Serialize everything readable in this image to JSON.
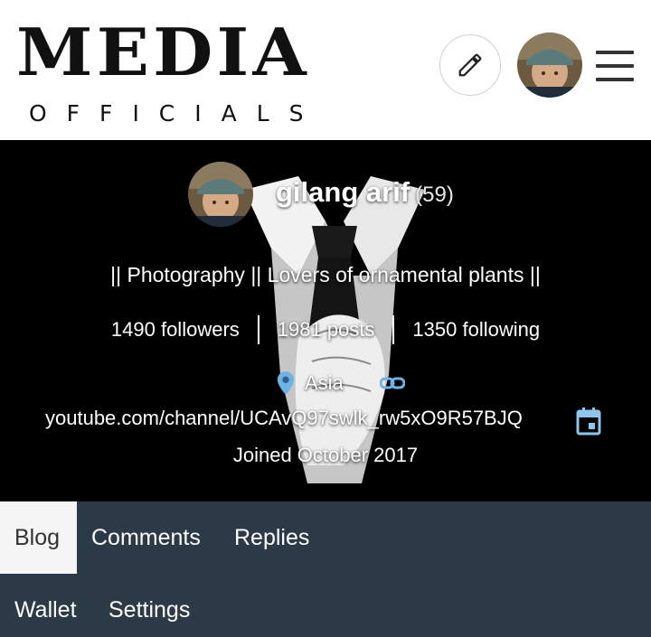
{
  "header": {
    "logo_main": "MEDIA",
    "logo_sub": "OFFICIALS",
    "edit_icon": "pencil-icon",
    "menu_icon": "hamburger-icon"
  },
  "profile": {
    "name": "gilang arif",
    "reputation": "(59)",
    "about": "|| Photography || Lovers of ornamental plants ||",
    "followers": "1490 followers",
    "posts": "1981 posts",
    "following": "1350 following",
    "location": "Asia",
    "website": "youtube.com/channel/UCAvQ97swlk_rw5xO9R57BJQ",
    "joined": "Joined October 2017"
  },
  "tabs": [
    {
      "label": "Blog",
      "active": true
    },
    {
      "label": "Comments",
      "active": false
    },
    {
      "label": "Replies",
      "active": false
    },
    {
      "label": "Wallet",
      "active": false
    },
    {
      "label": "Settings",
      "active": false
    }
  ],
  "colors": {
    "cover_bg": "#000000",
    "tab_bar": "#2c3a47",
    "active_tab": "#f5f5f5",
    "location_icon": "#6fb3e6"
  }
}
